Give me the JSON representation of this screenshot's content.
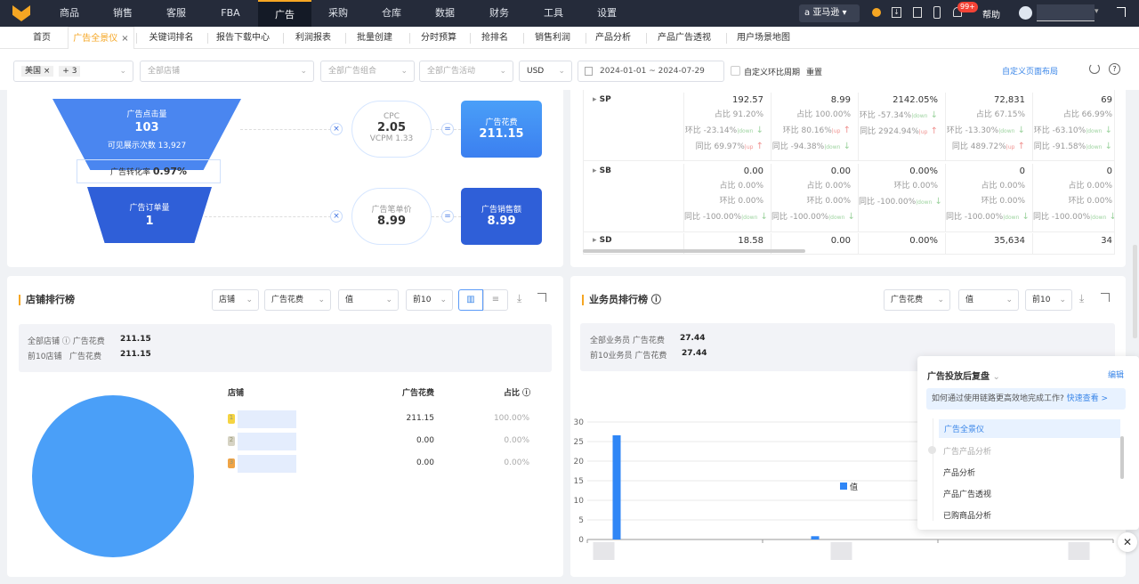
{
  "nav": {
    "items": [
      "商品",
      "销售",
      "客服",
      "FBA",
      "广告",
      "采购",
      "仓库",
      "数据",
      "财务",
      "工具",
      "设置"
    ],
    "active": "广告",
    "platform": "亚马逊",
    "badge": "99+",
    "help": "帮助"
  },
  "tabs": {
    "items": [
      "首页",
      "广告全景仪",
      "关键词排名",
      "报告下载中心",
      "利润报表",
      "批量创建",
      "分时预算",
      "抢排名",
      "销售利润",
      "产品分析",
      "产品广告透视",
      "用户场景地图"
    ],
    "active": "广告全景仪"
  },
  "filters": {
    "country": "美国",
    "more": "+ 3",
    "shop": "全部店铺",
    "group": "全部广告组合",
    "campaign": "全部广告活动",
    "currency": "USD",
    "date_start": "2024-01-01",
    "date_sep": "~",
    "date_end": "2024-07-29",
    "custom_period": "自定义环比周期",
    "reset": "重置",
    "custom_layout": "自定义页面布局"
  },
  "funnel": {
    "clicks_label": "广告点击量",
    "clicks": "103",
    "impr_label": "可见展示次数 13,927",
    "conv_label": "广告转化率",
    "conv": "0.97%",
    "orders_label": "广告订单量",
    "orders": "1",
    "cpc_label": "CPC",
    "cpc": "2.05",
    "vcpm": "VCPM 1.33",
    "spend_label": "广告花费",
    "spend": "211.15",
    "price_label": "广告笔单价",
    "price": "8.99",
    "sales_label": "广告销售额",
    "sales": "8.99",
    "times": "×",
    "eq": "="
  },
  "type_table": {
    "rows": [
      {
        "name": "SP",
        "cells": [
          [
            "192.57",
            "占比 91.20%",
            "环比 -23.14%|down",
            "同比 69.97%|up"
          ],
          [
            "8.99",
            "占比 100.00%",
            "环比 80.16%|up",
            "同比 -94.38%|down"
          ],
          [
            "2142.05%",
            "环比 -57.34%|down",
            "同比 2924.94%|up"
          ],
          [
            "72,831",
            "占比 67.15%",
            "环比 -13.30%|down",
            "同比 489.72%|up"
          ],
          [
            "69",
            "占比 66.99%",
            "环比 -63.10%|down",
            "同比 -91.58%|down"
          ]
        ]
      },
      {
        "name": "SB",
        "cells": [
          [
            "0.00",
            "占比 0.00%",
            "环比 0.00%",
            "同比 -100.00%|down"
          ],
          [
            "0.00",
            "占比 0.00%",
            "环比 0.00%",
            "同比 -100.00%|down"
          ],
          [
            "0.00%",
            "环比 0.00%",
            "同比 -100.00%|down"
          ],
          [
            "0",
            "占比 0.00%",
            "环比 0.00%",
            "同比 -100.00%|down"
          ],
          [
            "0",
            "占比 0.00%",
            "环比 0.00%",
            "同比 -100.00%|down"
          ]
        ]
      },
      {
        "name": "SD",
        "cells": [
          [
            "18.58"
          ],
          [
            "0.00"
          ],
          [
            "0.00%"
          ],
          [
            "35,634"
          ],
          [
            "34"
          ]
        ]
      }
    ]
  },
  "shop_rank": {
    "title": "店铺排行榜",
    "dims": [
      "店铺",
      "广告花费",
      "值",
      "前10"
    ],
    "all_label": "全部店铺",
    "metric": "广告花费",
    "all_value": "211.15",
    "top_label": "前10店铺",
    "top_value": "211.15",
    "cols": [
      "店铺",
      "广告花费",
      "占比"
    ],
    "rows": [
      {
        "rank": "1",
        "value": "211.15",
        "pct": "100.00%"
      },
      {
        "rank": "2",
        "value": "0.00",
        "pct": "0.00%"
      },
      {
        "rank": "3",
        "value": "0.00",
        "pct": "0.00%"
      }
    ],
    "pie_color": "#4a9ff8"
  },
  "staff_rank": {
    "title": "业务员排行榜",
    "dims": [
      "广告花费",
      "值",
      "前10"
    ],
    "all_label": "全部业务员 广告花费",
    "all_value": "27.44",
    "top_label": "前10业务员 广告花费",
    "top_value": "27.44"
  },
  "chart_data": {
    "type": "bar",
    "legend": [
      "值"
    ],
    "categories": [
      "",
      "",
      ""
    ],
    "values": [
      26.6,
      0.84,
      0
    ],
    "yticks": [
      "0",
      "5",
      "10",
      "15",
      "20",
      "25",
      "30"
    ],
    "ylim": [
      0,
      30
    ],
    "color": "#2f86f6"
  },
  "popup": {
    "title": "广告投放后复盘",
    "edit": "编辑",
    "tip": "如何通过使用链路更高效地完成工作?",
    "tip_link": "快速查看 >",
    "items": [
      "广告全景仪",
      "广告产品分析",
      "产品分析",
      "产品广告透视",
      "已购商品分析"
    ]
  }
}
